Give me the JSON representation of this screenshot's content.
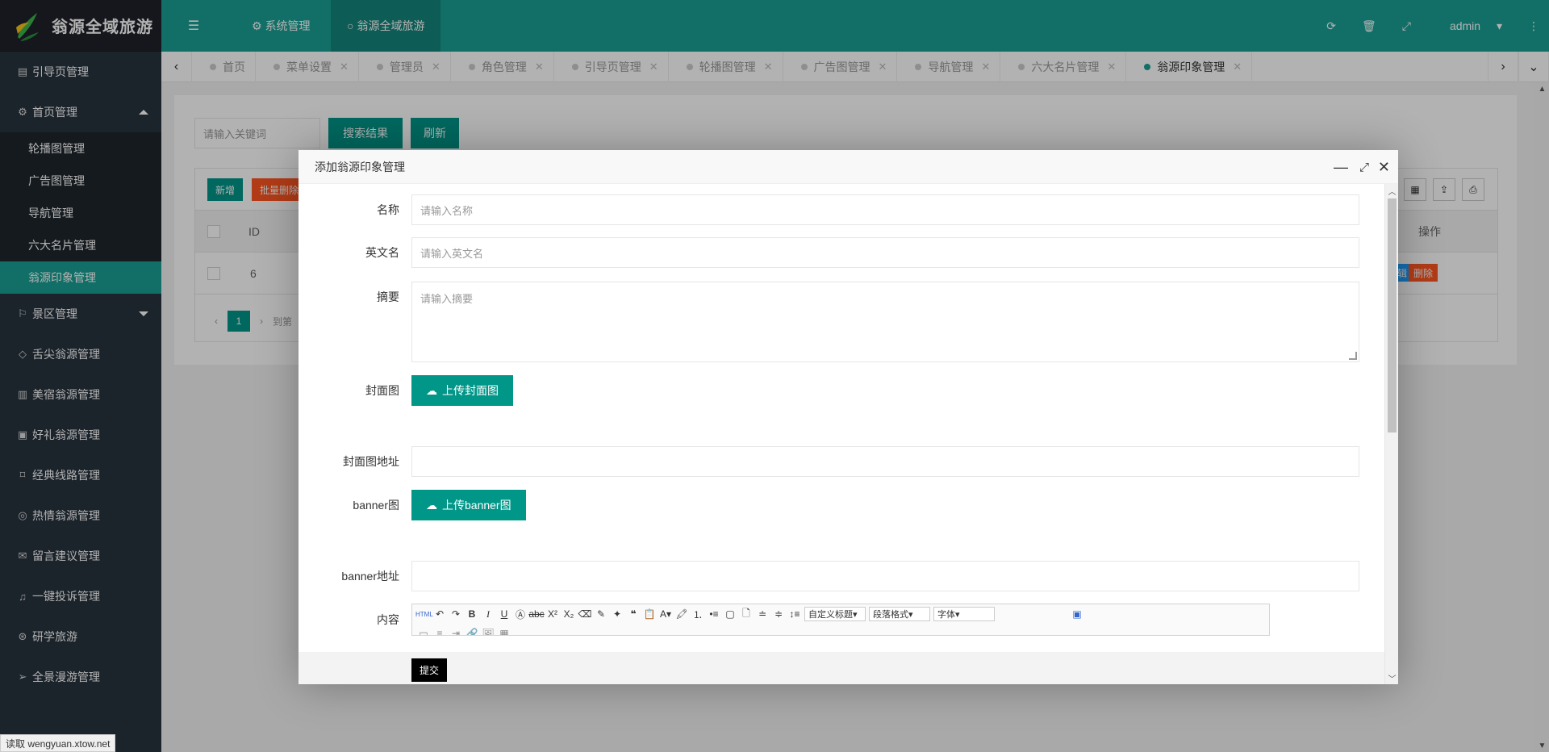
{
  "app": {
    "logo_text": "翁源全域旅游"
  },
  "sidebar": {
    "items": [
      {
        "label": "引导页管理",
        "icon": "book-icon"
      },
      {
        "label": "首页管理",
        "icon": "gear-icon",
        "expanded": true,
        "children": [
          "轮播图管理",
          "广告图管理",
          "导航管理",
          "六大名片管理",
          "翁源印象管理"
        ]
      },
      {
        "label": "景区管理",
        "icon": "flag-icon",
        "collapsed": true
      },
      {
        "label": "舌尖翁源管理",
        "icon": "leaf-icon"
      },
      {
        "label": "美宿翁源管理",
        "icon": "building-icon"
      },
      {
        "label": "好礼翁源管理",
        "icon": "gift-icon"
      },
      {
        "label": "经典线路管理",
        "icon": "bookmark-icon"
      },
      {
        "label": "热情翁源管理",
        "icon": "instagram-icon"
      },
      {
        "label": "留言建议管理",
        "icon": "mail-icon"
      },
      {
        "label": "一键投诉管理",
        "icon": "bell-icon"
      },
      {
        "label": "研学旅游",
        "icon": "dribbble-icon"
      },
      {
        "label": "全景漫游管理",
        "icon": "paper-plane-icon"
      }
    ]
  },
  "header": {
    "tabs": [
      {
        "label": "系统管理",
        "icon": "gears-icon"
      },
      {
        "label": "翁源全域旅游",
        "icon": "circle-icon",
        "active": true
      }
    ],
    "user": "admin"
  },
  "tabbar": {
    "tabs": [
      "首页",
      "菜单设置",
      "管理员",
      "角色管理",
      "引导页管理",
      "轮播图管理",
      "广告图管理",
      "导航管理",
      "六大名片管理",
      "翁源印象管理"
    ],
    "active_index": 9
  },
  "search": {
    "placeholder": "请输入关键词",
    "search_label": "搜索结果",
    "refresh_label": "刷新"
  },
  "table": {
    "add_label": "新增",
    "batch_delete_label": "批量删除",
    "col_id": "ID",
    "col_action": "操作",
    "rows": [
      {
        "id": "6"
      }
    ],
    "edit_label": "编辑",
    "delete_label": "删除",
    "page": "1",
    "goto_label": "到第"
  },
  "modal": {
    "title": "添加翁源印象管理",
    "fields": {
      "name_label": "名称",
      "name_placeholder": "请输入名称",
      "en_label": "英文名",
      "en_placeholder": "请输入英文名",
      "summary_label": "摘要",
      "summary_placeholder": "请输入摘要",
      "cover_label": "封面图",
      "cover_btn": "上传封面图",
      "cover_url_label": "封面图地址",
      "banner_label": "banner图",
      "banner_btn": "上传banner图",
      "banner_url_label": "banner地址",
      "content_label": "内容"
    },
    "editor": {
      "heading_select": "自定义标题",
      "para_select": "段落格式",
      "font_select": "字体",
      "html_btn": "HTML"
    },
    "submit_label": "提交"
  },
  "statusbar": {
    "text": "读取 wengyuan.xtow.net"
  },
  "colors": {
    "accent": "#1aa094",
    "button": "#009688",
    "danger": "#ff5722",
    "info": "#1e9fff",
    "sidebar": "#28333e"
  }
}
